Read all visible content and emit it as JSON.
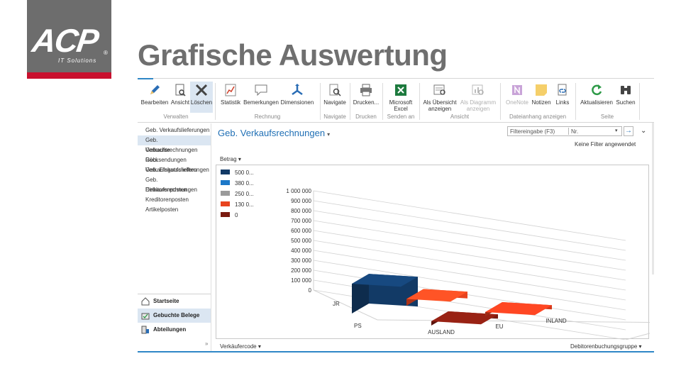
{
  "logo": {
    "text": "ACP",
    "subtitle": "IT Solutions",
    "mark": "®"
  },
  "title": "Grafische Auswertung",
  "ribbon": {
    "buttons": [
      {
        "label": "Bearbeiten",
        "icon": "pencil-icon"
      },
      {
        "label": "Ansicht",
        "icon": "view-document-icon"
      },
      {
        "label": "Löschen",
        "icon": "delete-x-icon"
      },
      {
        "label": "Statistik",
        "icon": "statistics-icon"
      },
      {
        "label": "Bemerkungen",
        "icon": "comment-icon"
      },
      {
        "label": "Dimensionen",
        "icon": "dimensions-icon"
      },
      {
        "label": "Navigate",
        "icon": "navigate-icon"
      },
      {
        "label": "Drucken...",
        "icon": "printer-icon"
      },
      {
        "label": "Microsoft Excel",
        "icon": "excel-icon"
      },
      {
        "label": "Als Übersicht anzeigen",
        "icon": "list-view-icon"
      },
      {
        "label": "Als Diagramm anzeigen",
        "icon": "chart-view-icon"
      },
      {
        "label": "OneNote",
        "icon": "onenote-icon"
      },
      {
        "label": "Notizen",
        "icon": "note-icon"
      },
      {
        "label": "Links",
        "icon": "link-icon"
      },
      {
        "label": "Aktualisieren",
        "icon": "refresh-icon"
      },
      {
        "label": "Suchen",
        "icon": "binoculars-icon"
      }
    ],
    "groups": [
      "Verwalten",
      "Rechnung",
      "Navigate",
      "Drucken",
      "Senden an",
      "Ansicht",
      "Dateianhang anzeigen",
      "Seite"
    ]
  },
  "nav": {
    "items": [
      "Geb. Verkaufslieferungen",
      "Geb. Verkaufsrechnungen",
      "Gebuchte Rücksendungen",
      "Geb. Verkaufsgutschriften",
      "Geb. Einkaufslieferungen",
      "Geb. Einkaufsrechnungen",
      "Debitorenposten",
      "Kreditorenposten",
      "Artikelposten"
    ],
    "bottom": [
      "Startseite",
      "Gebuchte Belege",
      "Abteilungen"
    ],
    "grip": "»"
  },
  "content": {
    "page_title": "Geb. Verkaufsrechnungen",
    "filter_placeholder": "Filtereingabe (F3)",
    "filter_field": "Nr.",
    "no_filter": "Keine Filter angewendet",
    "measure": "Betrag",
    "x_field": "Verkäufercode",
    "series_field": "Debitorenbuchungsgruppe"
  },
  "chart_data": {
    "type": "bar",
    "legend": [
      {
        "label": "500 0...",
        "color": "#123a66"
      },
      {
        "label": "380 0...",
        "color": "#1c78c8"
      },
      {
        "label": "250 0...",
        "color": "#9a9a9a"
      },
      {
        "label": "130 0...",
        "color": "#e8431e"
      },
      {
        "label": "0",
        "color": "#7a1b10"
      }
    ],
    "yticks": [
      "1 000 000",
      "900 000",
      "800 000",
      "700 000",
      "600 000",
      "500 000",
      "400 000",
      "300 000",
      "200 000",
      "100 000",
      "0"
    ],
    "ylim": [
      0,
      1000000
    ],
    "rows": [
      "JR",
      "PS"
    ],
    "categories": [
      "AUSLAND",
      "EU",
      "INLAND"
    ],
    "bars": [
      {
        "row": "JR",
        "category": "AUSLAND",
        "value": 440000,
        "color": "#123a66"
      },
      {
        "row": "JR",
        "category": "EU",
        "value": 100000,
        "color": "#e8431e"
      },
      {
        "row": "PS",
        "category": "EU",
        "value": 20000,
        "color": "#7a1b10"
      },
      {
        "row": "PS",
        "category": "INLAND",
        "value": 60000,
        "color": "#d4391c"
      }
    ]
  }
}
